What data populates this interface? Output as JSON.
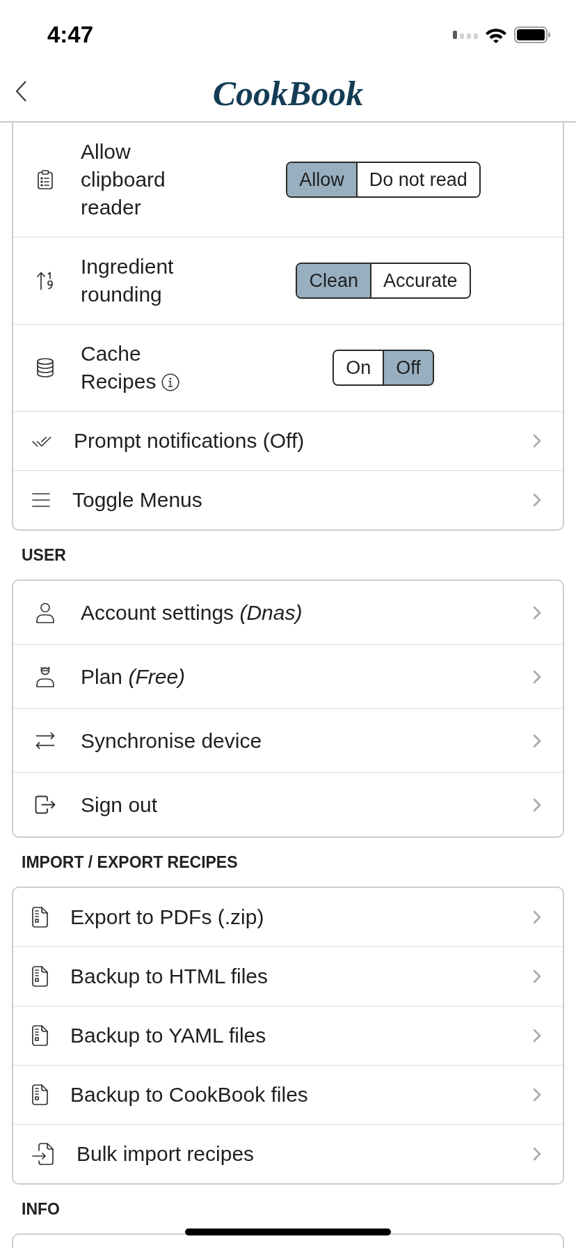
{
  "status_bar": {
    "time": "4:47"
  },
  "header": {
    "title": "CookBook"
  },
  "sections": [
    {
      "items": [
        {
          "kind": "choice",
          "label": "Allow clipboard reader",
          "info_icon": false,
          "options": [
            {
              "label": "Allow",
              "selected": true
            },
            {
              "label": "Do not read",
              "selected": false
            }
          ]
        },
        {
          "kind": "choice",
          "label": "Ingredient rounding",
          "info_icon": false,
          "options": [
            {
              "label": "Clean",
              "selected": true
            },
            {
              "label": "Accurate",
              "selected": false
            }
          ]
        },
        {
          "kind": "choice",
          "label": "Cache Recipes",
          "info_icon": true,
          "options": [
            {
              "label": "On",
              "selected": false
            },
            {
              "label": "Off",
              "selected": true
            }
          ]
        },
        {
          "kind": "link",
          "label": "Prompt notifications (Off)"
        },
        {
          "kind": "link",
          "label": "Toggle Menus"
        }
      ]
    },
    {
      "title": "USER",
      "items": [
        {
          "kind": "link",
          "label": "Account settings *(Dnas)*"
        },
        {
          "kind": "link",
          "label": "Plan *(Free)*"
        },
        {
          "kind": "link",
          "label": "Synchronise device"
        },
        {
          "kind": "link",
          "label": "Sign out"
        }
      ]
    },
    {
      "title": "IMPORT / EXPORT RECIPES",
      "items": [
        {
          "kind": "link",
          "label": "Export to PDFs (.zip)"
        },
        {
          "kind": "link",
          "label": "Backup to HTML files"
        },
        {
          "kind": "link",
          "label": "Backup to YAML files"
        },
        {
          "kind": "link",
          "label": "Backup to CookBook files"
        },
        {
          "kind": "link",
          "label": "Bulk import recipes"
        }
      ]
    },
    {
      "title": "INFO"
    }
  ]
}
